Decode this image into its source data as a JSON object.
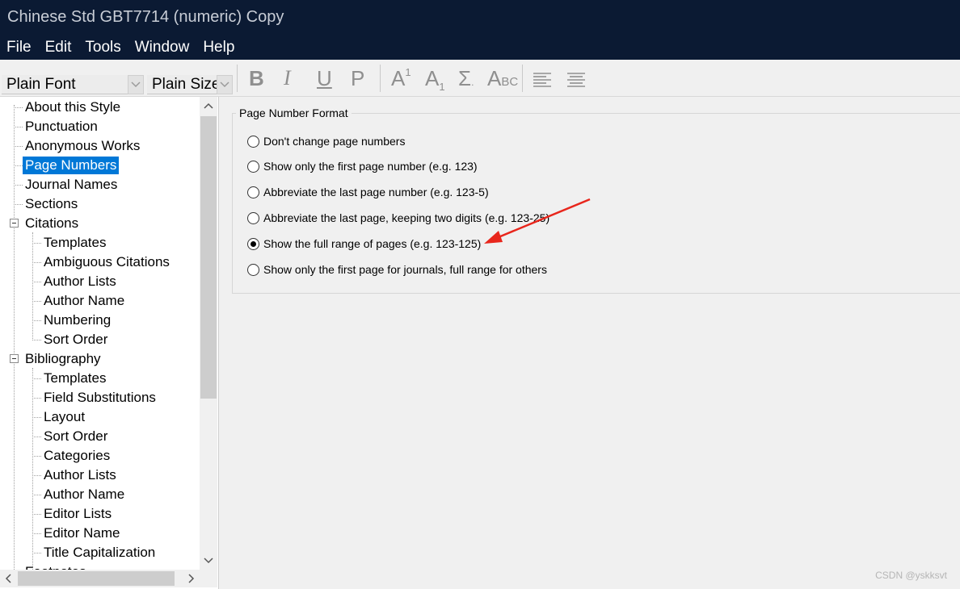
{
  "window": {
    "title": "Chinese Std GBT7714 (numeric) Copy"
  },
  "menu": [
    "File",
    "Edit",
    "Tools",
    "Window",
    "Help"
  ],
  "toolbar": {
    "font_combo": "Plain Font",
    "size_combo": "Plain Size",
    "buttons": [
      "bold-icon",
      "italic-icon",
      "underline-icon",
      "plain-icon",
      "superscript-icon",
      "subscript-icon",
      "symbol-icon",
      "small-caps-icon",
      "align-left-icon",
      "justify-icon"
    ]
  },
  "tree": {
    "items": [
      {
        "label": "About this Style"
      },
      {
        "label": "Punctuation"
      },
      {
        "label": "Anonymous Works"
      },
      {
        "label": "Page Numbers",
        "selected": true
      },
      {
        "label": "Journal Names"
      },
      {
        "label": "Sections"
      },
      {
        "label": "Citations",
        "expanded": true
      },
      {
        "label": "Templates"
      },
      {
        "label": "Ambiguous Citations"
      },
      {
        "label": "Author Lists"
      },
      {
        "label": "Author Name"
      },
      {
        "label": "Numbering"
      },
      {
        "label": "Sort Order"
      },
      {
        "label": "Bibliography",
        "expanded": true
      },
      {
        "label": "Templates"
      },
      {
        "label": "Field Substitutions"
      },
      {
        "label": "Layout"
      },
      {
        "label": "Sort Order"
      },
      {
        "label": "Categories"
      },
      {
        "label": "Author Lists"
      },
      {
        "label": "Author Name"
      },
      {
        "label": "Editor Lists"
      },
      {
        "label": "Editor Name"
      },
      {
        "label": "Title Capitalization"
      },
      {
        "label": "Footnotes"
      }
    ]
  },
  "page_number_format": {
    "legend": "Page Number Format",
    "options": [
      {
        "label": "Don't change page numbers",
        "checked": false
      },
      {
        "label": "Show only the first page number (e.g. 123)",
        "checked": false
      },
      {
        "label": "Abbreviate the last page number (e.g. 123-5)",
        "checked": false
      },
      {
        "label": "Abbreviate the last page, keeping two digits (e.g. 123-25)",
        "checked": false
      },
      {
        "label": "Show the full range of pages (e.g. 123-125)",
        "checked": true
      },
      {
        "label": "Show only the first page for journals, full range for others",
        "checked": false
      }
    ]
  },
  "annotation": {
    "color": "#e8261c"
  },
  "watermark": "CSDN @yskksvt"
}
